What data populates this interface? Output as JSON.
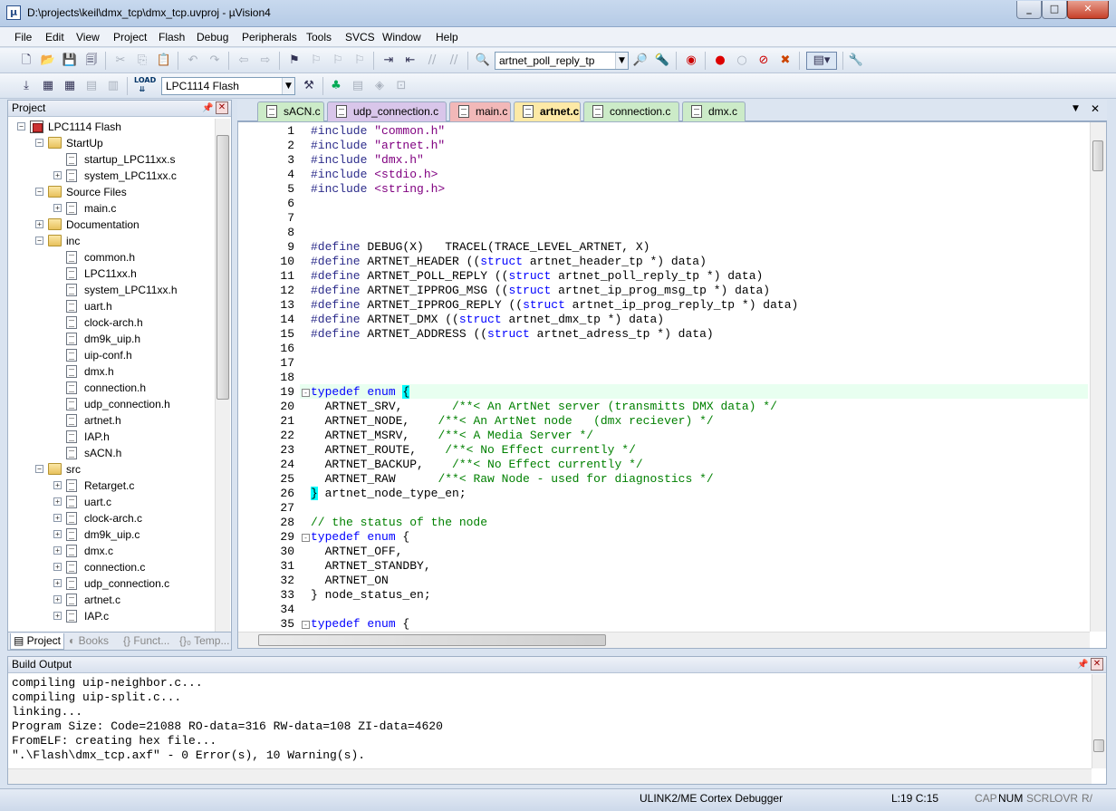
{
  "window": {
    "title": "D:\\projects\\keil\\dmx_tcp\\dmx_tcp.uvproj - µVision4",
    "app_icon": "µ"
  },
  "menu": [
    "File",
    "Edit",
    "View",
    "Project",
    "Flash",
    "Debug",
    "Peripherals",
    "Tools",
    "SVCS",
    "Window",
    "Help"
  ],
  "toolbar": {
    "find_combo": "artnet_poll_reply_tp",
    "target_combo": "LPC1114 Flash",
    "load_label": "LOAD"
  },
  "project_panel": {
    "title": "Project",
    "tree": [
      {
        "label": "LPC1114 Flash",
        "type": "proj",
        "depth": 0,
        "exp": "-"
      },
      {
        "label": "StartUp",
        "type": "folder",
        "depth": 1,
        "exp": "-"
      },
      {
        "label": "startup_LPC11xx.s",
        "type": "file",
        "depth": 2,
        "exp": ""
      },
      {
        "label": "system_LPC11xx.c",
        "type": "file",
        "depth": 2,
        "exp": "+"
      },
      {
        "label": "Source Files",
        "type": "folder",
        "depth": 1,
        "exp": "-"
      },
      {
        "label": "main.c",
        "type": "file",
        "depth": 2,
        "exp": "+"
      },
      {
        "label": "Documentation",
        "type": "folder",
        "depth": 1,
        "exp": "+"
      },
      {
        "label": "inc",
        "type": "folder",
        "depth": 1,
        "exp": "-"
      },
      {
        "label": "common.h",
        "type": "file",
        "depth": 2,
        "exp": ""
      },
      {
        "label": "LPC11xx.h",
        "type": "file",
        "depth": 2,
        "exp": ""
      },
      {
        "label": "system_LPC11xx.h",
        "type": "file",
        "depth": 2,
        "exp": ""
      },
      {
        "label": "uart.h",
        "type": "file",
        "depth": 2,
        "exp": ""
      },
      {
        "label": "clock-arch.h",
        "type": "file",
        "depth": 2,
        "exp": ""
      },
      {
        "label": "dm9k_uip.h",
        "type": "file",
        "depth": 2,
        "exp": ""
      },
      {
        "label": "uip-conf.h",
        "type": "file",
        "depth": 2,
        "exp": ""
      },
      {
        "label": "dmx.h",
        "type": "file",
        "depth": 2,
        "exp": ""
      },
      {
        "label": "connection.h",
        "type": "file",
        "depth": 2,
        "exp": ""
      },
      {
        "label": "udp_connection.h",
        "type": "file",
        "depth": 2,
        "exp": ""
      },
      {
        "label": "artnet.h",
        "type": "file",
        "depth": 2,
        "exp": ""
      },
      {
        "label": "IAP.h",
        "type": "file",
        "depth": 2,
        "exp": ""
      },
      {
        "label": "sACN.h",
        "type": "file",
        "depth": 2,
        "exp": ""
      },
      {
        "label": "src",
        "type": "folder",
        "depth": 1,
        "exp": "-"
      },
      {
        "label": "Retarget.c",
        "type": "file",
        "depth": 2,
        "exp": "+"
      },
      {
        "label": "uart.c",
        "type": "file",
        "depth": 2,
        "exp": "+"
      },
      {
        "label": "clock-arch.c",
        "type": "file",
        "depth": 2,
        "exp": "+"
      },
      {
        "label": "dm9k_uip.c",
        "type": "file",
        "depth": 2,
        "exp": "+"
      },
      {
        "label": "dmx.c",
        "type": "file",
        "depth": 2,
        "exp": "+"
      },
      {
        "label": "connection.c",
        "type": "file",
        "depth": 2,
        "exp": "+"
      },
      {
        "label": "udp_connection.c",
        "type": "file",
        "depth": 2,
        "exp": "+"
      },
      {
        "label": "artnet.c",
        "type": "file",
        "depth": 2,
        "exp": "+"
      },
      {
        "label": "IAP.c",
        "type": "file",
        "depth": 2,
        "exp": "+"
      }
    ],
    "tabs": [
      "Project",
      "Books",
      "{} Funct...",
      "{}₀ Temp..."
    ]
  },
  "editor_tabs": [
    {
      "label": "sACN.c",
      "color": "#ccebc8"
    },
    {
      "label": "udp_connection.c",
      "color": "#d9c6ea"
    },
    {
      "label": "main.c",
      "color": "#f2b8b8"
    },
    {
      "label": "artnet.c",
      "color": "#fde9a6"
    },
    {
      "label": "connection.c",
      "color": "#ccebc8"
    },
    {
      "label": "dmx.c",
      "color": "#ccebc8"
    }
  ],
  "code_lines": [
    "1",
    "2",
    "3",
    "4",
    "5",
    "6",
    "7",
    "8",
    "9",
    "10",
    "11",
    "12",
    "13",
    "14",
    "15",
    "16",
    "17",
    "18",
    "19",
    "20",
    "21",
    "22",
    "23",
    "24",
    "25",
    "26",
    "27",
    "28",
    "29",
    "30",
    "31",
    "32",
    "33",
    "34",
    "35"
  ],
  "code": {
    "l1a": "#include ",
    "l1b": "\"common.h\"",
    "l2a": "#include ",
    "l2b": "\"artnet.h\"",
    "l3a": "#include ",
    "l3b": "\"dmx.h\"",
    "l4a": "#include ",
    "l4b": "<stdio.h>",
    "l5a": "#include ",
    "l5b": "<string.h>",
    "l9a": "#define ",
    "l9b": "DEBUG(X)   TRACEL(TRACE_LEVEL_ARTNET, X)",
    "l10a": "#define ",
    "l10b": "ARTNET_HEADER ((",
    "l10c": "struct",
    "l10d": " artnet_header_tp *) data)",
    "l11a": "#define ",
    "l11b": "ARTNET_POLL_REPLY ((",
    "l11c": "struct",
    "l11d": " artnet_poll_reply_tp *) data)",
    "l12a": "#define ",
    "l12b": "ARTNET_IPPROG_MSG ((",
    "l12c": "struct",
    "l12d": " artnet_ip_prog_msg_tp *) data)",
    "l13a": "#define ",
    "l13b": "ARTNET_IPPROG_REPLY ((",
    "l13c": "struct",
    "l13d": " artnet_ip_prog_reply_tp *) data)",
    "l14a": "#define ",
    "l14b": "ARTNET_DMX ((",
    "l14c": "struct",
    "l14d": " artnet_dmx_tp *) data)",
    "l15a": "#define ",
    "l15b": "ARTNET_ADDRESS ((",
    "l15c": "struct",
    "l15d": " artnet_adress_tp *) data)",
    "l19a": "typedef enum ",
    "l19b": "{",
    "l20a": "  ARTNET_SRV,       ",
    "l20b": "/**< An ArtNet server (transmitts DMX data) */",
    "l21a": "  ARTNET_NODE,    ",
    "l21b": "/**< An ArtNet node   (dmx reciever) */",
    "l22a": "  ARTNET_MSRV,    ",
    "l22b": "/**< A Media Server */",
    "l23a": "  ARTNET_ROUTE,    ",
    "l23b": "/**< No Effect currently */",
    "l24a": "  ARTNET_BACKUP,    ",
    "l24b": "/**< No Effect currently */",
    "l25a": "  ARTNET_RAW      ",
    "l25b": "/**< Raw Node - used for diagnostics */",
    "l26a": "}",
    "l26b": " artnet_node_type_en;",
    "l28": "// the status of the node",
    "l29a": "typedef enum ",
    "l29b": "{",
    "l30": "  ARTNET_OFF,",
    "l31": "  ARTNET_STANDBY,",
    "l32": "  ARTNET_ON",
    "l33": "} node_status_en;",
    "l35a": "typedef enum ",
    "l35b": "{"
  },
  "build_output": {
    "title": "Build Output",
    "lines": [
      "compiling uip-neighbor.c...",
      "compiling uip-split.c...",
      "linking...",
      "Program Size: Code=21088 RO-data=316 RW-data=108 ZI-data=4620",
      "FromELF: creating hex file...",
      "\".\\Flash\\dmx_tcp.axf\" - 0 Error(s), 10 Warning(s)."
    ]
  },
  "status": {
    "debugger": "ULINK2/ME Cortex Debugger",
    "position": "L:19 C:15",
    "cap": "CAP",
    "num": "NUM",
    "scrl": "SCRL",
    "ovr": "OVR",
    "rw": "R/"
  }
}
